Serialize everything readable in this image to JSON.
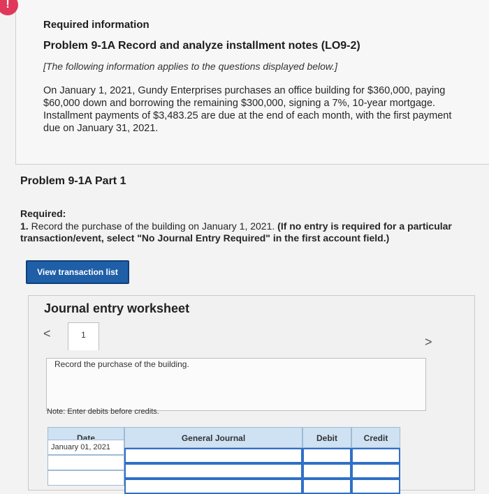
{
  "alert_icon": "!",
  "header": {
    "required_info": "Required information",
    "problem_title": "Problem 9-1A Record and analyze installment notes (LO9-2)",
    "subtitle": "[The following information applies to the questions displayed below.]",
    "body": "On January 1, 2021, Gundy Enterprises purchases an office building for $360,000, paying $60,000 down and borrowing the remaining $300,000, signing a 7%, 10-year mortgage. Installment payments of $3,483.25 are due at the end of each month, with the first payment due on January 31, 2021."
  },
  "part": {
    "title": "Problem 9-1A Part 1",
    "required_label": "Required:",
    "instruction_num": "1.",
    "instruction_text": "Record the purchase of the building on January 1, 2021.",
    "instruction_note": "(If no entry is required for a particular transaction/event, select \"No Journal Entry Required\" in the first account field.)"
  },
  "button": {
    "view_transaction": "View transaction list"
  },
  "worksheet": {
    "title": "Journal entry worksheet",
    "nav_left": "<",
    "nav_right": ">",
    "tab_number": "1",
    "description": "Record the purchase of the building.",
    "note": "Note: Enter debits before credits.",
    "columns": [
      "Date",
      "General Journal",
      "Debit",
      "Credit"
    ],
    "rows": [
      {
        "date": "January 01, 2021",
        "account": "",
        "debit": "",
        "credit": ""
      },
      {
        "date": "",
        "account": "",
        "debit": "",
        "credit": ""
      },
      {
        "date": "",
        "account": "",
        "debit": "",
        "credit": ""
      }
    ]
  }
}
